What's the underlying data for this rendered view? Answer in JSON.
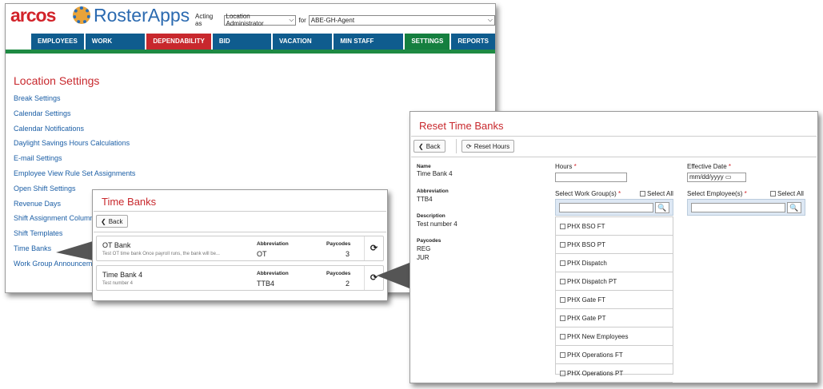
{
  "header": {
    "brand1": "arcos",
    "brand2": "RosterApps",
    "acting_as_label": "Acting as",
    "role": "Location Administrator",
    "for_label": "for",
    "agent": "ABE-GH-Agent"
  },
  "nav": [
    "EMPLOYEES",
    "WORK GROUPS",
    "DEPENDABILITY",
    "BID PACKAGES",
    "VACATION BIDS",
    "MIN STAFF LEVELS",
    "SETTINGS",
    "REPORTS"
  ],
  "page": {
    "title": "Location Settings",
    "links": [
      "Break Settings",
      "Calendar Settings",
      "Calendar Notifications",
      "Daylight Savings Hours Calculations",
      "E-mail Settings",
      "Employee View Rule Set Assignments",
      "Open Shift Settings",
      "Revenue Days",
      "Shift Assignment Column",
      "Shift Templates",
      "Time Banks",
      "Work Group Announcem"
    ]
  },
  "time_banks": {
    "title": "Time Banks",
    "back": "Back",
    "abbr_label": "Abbreviation",
    "paycodes_label": "Paycodes",
    "rows": [
      {
        "name": "OT Bank",
        "desc": "Test OT time bank Once payroll runs, the bank will be...",
        "abbr": "OT",
        "paycodes": "3"
      },
      {
        "name": "Time Bank 4",
        "desc": "Test number 4",
        "abbr": "TTB4",
        "paycodes": "2"
      }
    ]
  },
  "reset": {
    "title": "Reset Time Banks",
    "back": "Back",
    "reset_hours": "Reset Hours",
    "name_label": "Name",
    "name": "Time Bank 4",
    "abbr_label": "Abbreviation",
    "abbr": "TTB4",
    "desc_label": "Description",
    "desc": "Test number 4",
    "paycodes_label": "Paycodes",
    "paycode1": "REG",
    "paycode2": "JUR",
    "hours_label": "Hours",
    "date_label": "Effective Date",
    "date_placeholder": "mm/dd/yyyy",
    "wg_label": "Select Work Group(s)",
    "emp_label": "Select Employee(s)",
    "select_all": "Select All",
    "work_groups": [
      "PHX BSO FT",
      "PHX BSO PT",
      "PHX Dispatch",
      "PHX Dispatch PT",
      "PHX Gate FT",
      "PHX Gate PT",
      "PHX New Employees",
      "PHX Operations FT",
      "PHX Operations PT"
    ]
  },
  "colors": {
    "accent": "#c8282d",
    "nav": "#0f5c8e",
    "active": "#157f3f"
  }
}
